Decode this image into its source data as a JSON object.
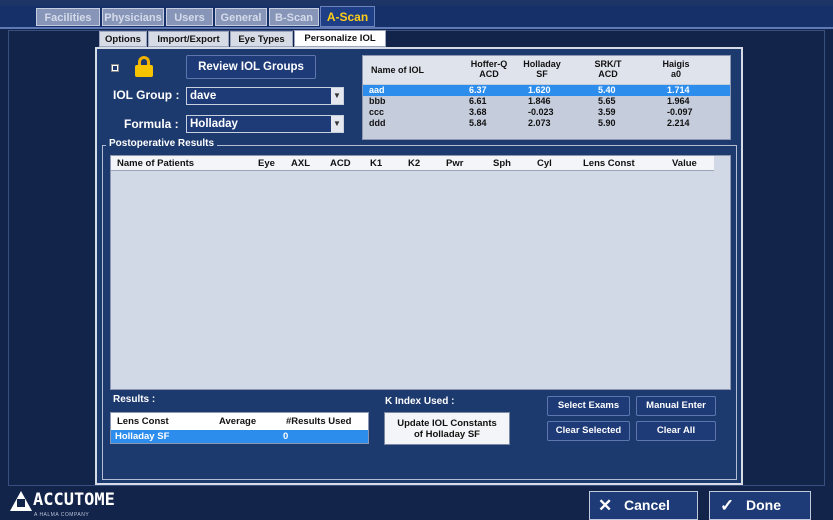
{
  "top_tabs": [
    "Facilities",
    "Physicians",
    "Users",
    "General",
    "B-Scan",
    "A-Scan"
  ],
  "sub_tabs": [
    "Options",
    "Import/Export",
    "Eye Types",
    "Personalize IOL"
  ],
  "controls": {
    "review_button": "Review IOL Groups",
    "iol_group_label": "IOL Group :",
    "iol_group_value": "dave",
    "formula_label": "Formula :",
    "formula_value": "Holladay"
  },
  "iol_table": {
    "headers": [
      "Name of IOL",
      "Hoffer-Q\nACD",
      "Holladay\nSF",
      "SRK/T\nACD",
      "Haigis\na0"
    ],
    "rows": [
      [
        "aad",
        "6.37",
        "1.620",
        "5.40",
        "1.714"
      ],
      [
        "bbb",
        "6.61",
        "1.846",
        "5.65",
        "1.964"
      ],
      [
        "ccc",
        "3.68",
        "-0.023",
        "3.59",
        "-0.097"
      ],
      [
        "ddd",
        "5.84",
        "2.073",
        "5.90",
        "2.214"
      ]
    ],
    "selected_row": 0
  },
  "postop": {
    "title": "Postoperative Results",
    "headers": [
      "Name of Patients",
      "Eye",
      "AXL",
      "ACD",
      "K1",
      "K2",
      "Pwr",
      "Sph",
      "Cyl",
      "Lens Const",
      "Value"
    ]
  },
  "results": {
    "title": "Results :",
    "headers": [
      "Lens Const",
      "Average",
      "#Results Used"
    ],
    "row": [
      "Holladay SF",
      "",
      "0"
    ]
  },
  "k_index": {
    "label": "K Index Used :",
    "update_line1": "Update IOL Constants",
    "update_line2": "of Holladay SF"
  },
  "actions": {
    "select_exams": "Select Exams",
    "manual_enter": "Manual Enter",
    "clear_selected": "Clear Selected",
    "clear_all": "Clear All"
  },
  "footer": {
    "logo_name": "ACCUTOME",
    "logo_tag": "A HALMA COMPANY",
    "cancel": "Cancel",
    "done": "Done"
  }
}
